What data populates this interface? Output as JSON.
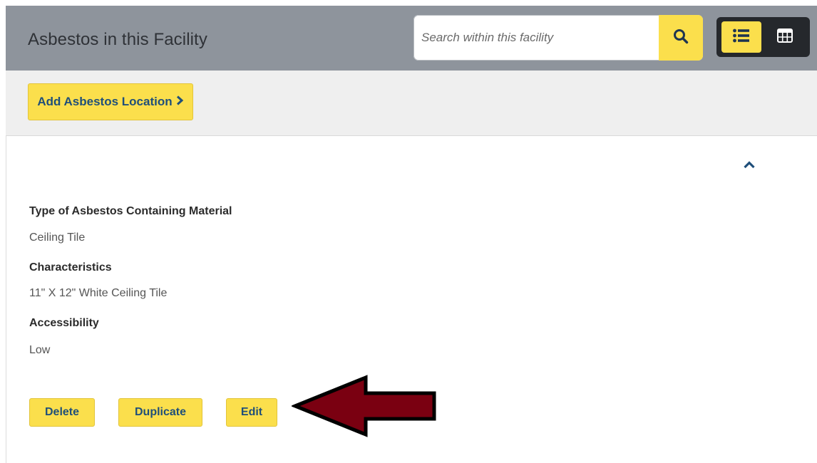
{
  "header": {
    "title": "Asbestos in this Facility",
    "search": {
      "placeholder": "Search within this facility",
      "value": ""
    },
    "search_icon": "search-icon",
    "view_toggle": {
      "list_icon": "list-icon",
      "grid_icon": "grid-icon",
      "active": "list"
    }
  },
  "actions": {
    "add_label": "Add Asbestos Location",
    "add_icon": "chevron-right-icon"
  },
  "record": {
    "collapse_icon": "chevron-up-icon",
    "fields": [
      {
        "label": "Type of Asbestos Containing Material",
        "value": "Ceiling Tile"
      },
      {
        "label": "Characteristics",
        "value": "11\" X 12\" White Ceiling Tile"
      },
      {
        "label": "Accessibility",
        "value": "Low"
      }
    ],
    "buttons": {
      "delete": "Delete",
      "duplicate": "Duplicate",
      "edit": "Edit"
    }
  },
  "annotation": {
    "arrow_color": "#7a0011",
    "arrow_icon": "arrow-left-icon"
  },
  "colors": {
    "accent": "#fbdf4c",
    "header_bg": "#8e949c",
    "link": "#1f4f7a"
  }
}
